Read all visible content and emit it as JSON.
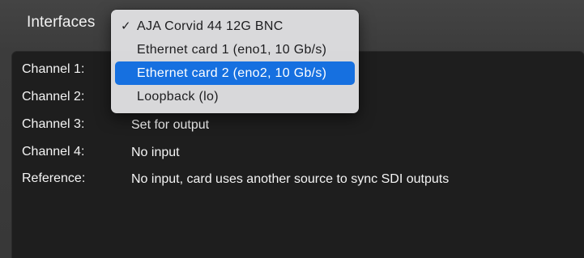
{
  "header": {
    "interfaces_label": "Interfaces"
  },
  "channels": [
    {
      "label": "Channel 1:",
      "value": ""
    },
    {
      "label": "Channel 2:",
      "value": ""
    },
    {
      "label": "Channel 3:",
      "value": "Set for output"
    },
    {
      "label": "Channel 4:",
      "value": "No input"
    },
    {
      "label": "Reference:",
      "value": "No input, card uses another source to sync SDI outputs"
    }
  ],
  "interface_menu": {
    "items": [
      {
        "label": "AJA Corvid 44 12G BNC",
        "checked": true,
        "highlighted": false
      },
      {
        "label": "Ethernet card 1 (eno1, 10 Gb/s)",
        "checked": false,
        "highlighted": false
      },
      {
        "label": "Ethernet card 2 (eno2, 10 Gb/s)",
        "checked": false,
        "highlighted": true
      },
      {
        "label": "Loopback (lo)",
        "checked": false,
        "highlighted": false
      }
    ],
    "check_glyph": "✓",
    "highlight_color": "#1670e0"
  }
}
